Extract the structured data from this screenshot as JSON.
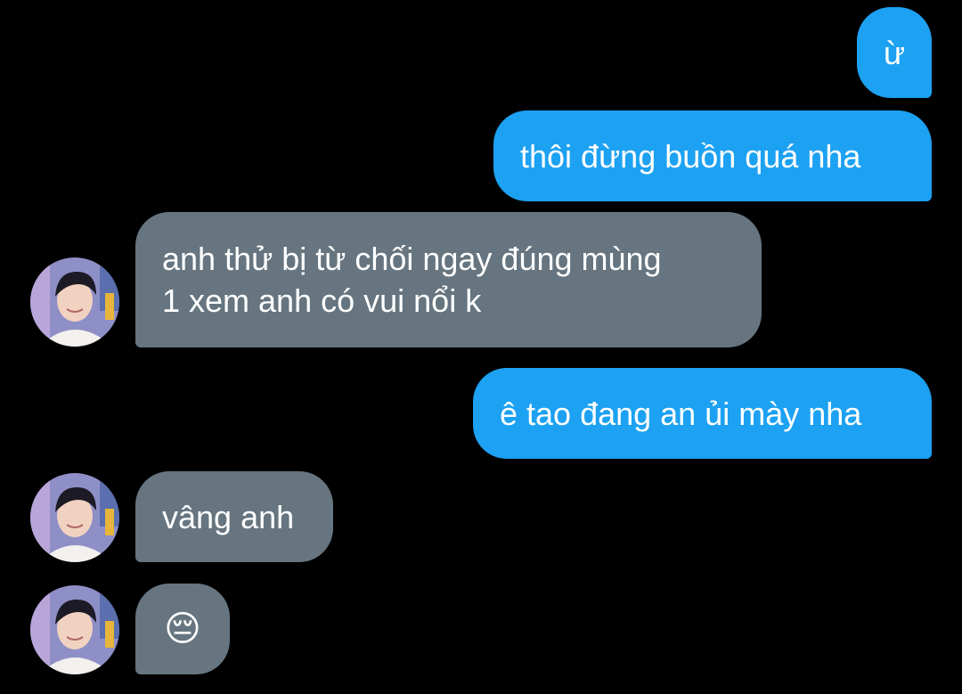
{
  "colors": {
    "background": "#000000",
    "outgoing_bubble": "#1da1f2",
    "incoming_bubble": "#66757f",
    "text": "#ffffff"
  },
  "messages": [
    {
      "direction": "outgoing",
      "text": "ừ"
    },
    {
      "direction": "outgoing",
      "text": "thôi đừng buồn quá nha"
    },
    {
      "direction": "incoming",
      "text": "anh thử bị từ chối ngay đúng mùng\n1 xem anh có vui nổi k",
      "avatar": "contact-avatar"
    },
    {
      "direction": "outgoing",
      "text": "ê tao đang an ủi mày nha"
    },
    {
      "direction": "incoming",
      "text": "vâng anh",
      "avatar": "contact-avatar"
    },
    {
      "direction": "incoming",
      "text": "😔",
      "avatar": "contact-avatar"
    }
  ]
}
